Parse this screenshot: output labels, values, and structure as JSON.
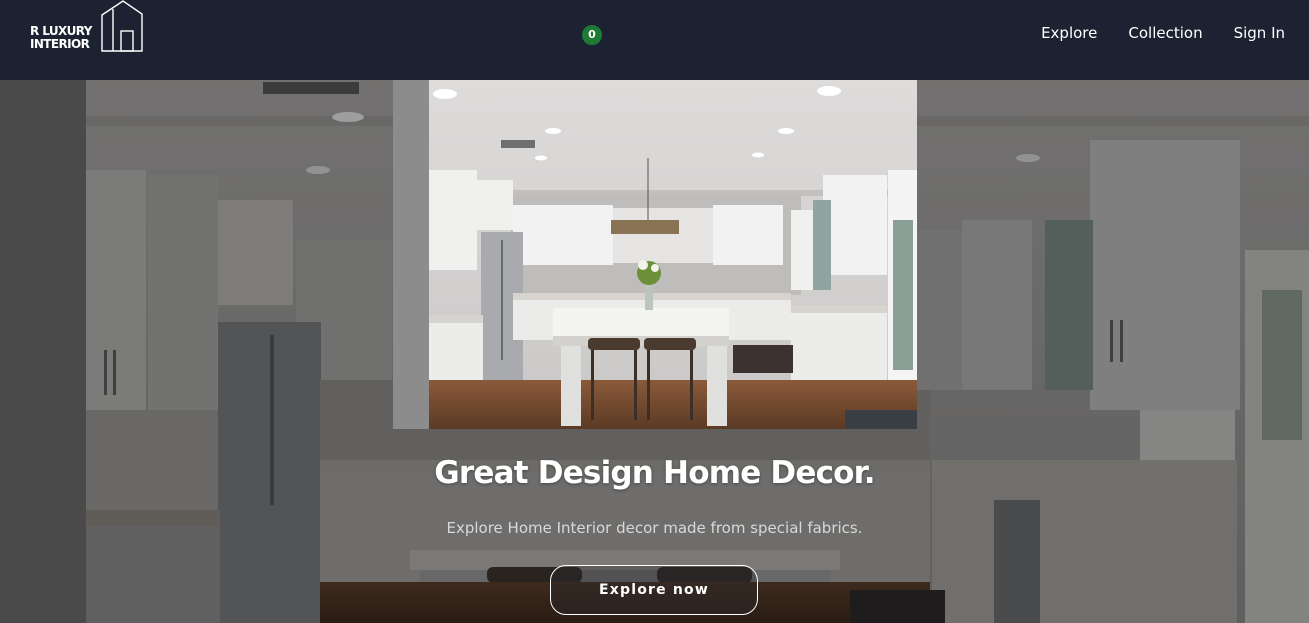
{
  "brand": {
    "line1": "R LUXURY",
    "line2": "INTERIOR",
    "icon": "house-icon"
  },
  "cart": {
    "count": "0",
    "badge_color": "#1f7a34"
  },
  "nav": {
    "links": [
      {
        "label": "Explore"
      },
      {
        "label": "Collection"
      },
      {
        "label": "Sign In"
      }
    ]
  },
  "hero": {
    "title": "Great Design Home Decor.",
    "subtitle": "Explore Home Interior decor made from special fabrics.",
    "cta_label": "Explore now",
    "image": "kitchen-interior-photo"
  },
  "colors": {
    "navbar_bg": "#1c2231",
    "text": "#ffffff"
  }
}
